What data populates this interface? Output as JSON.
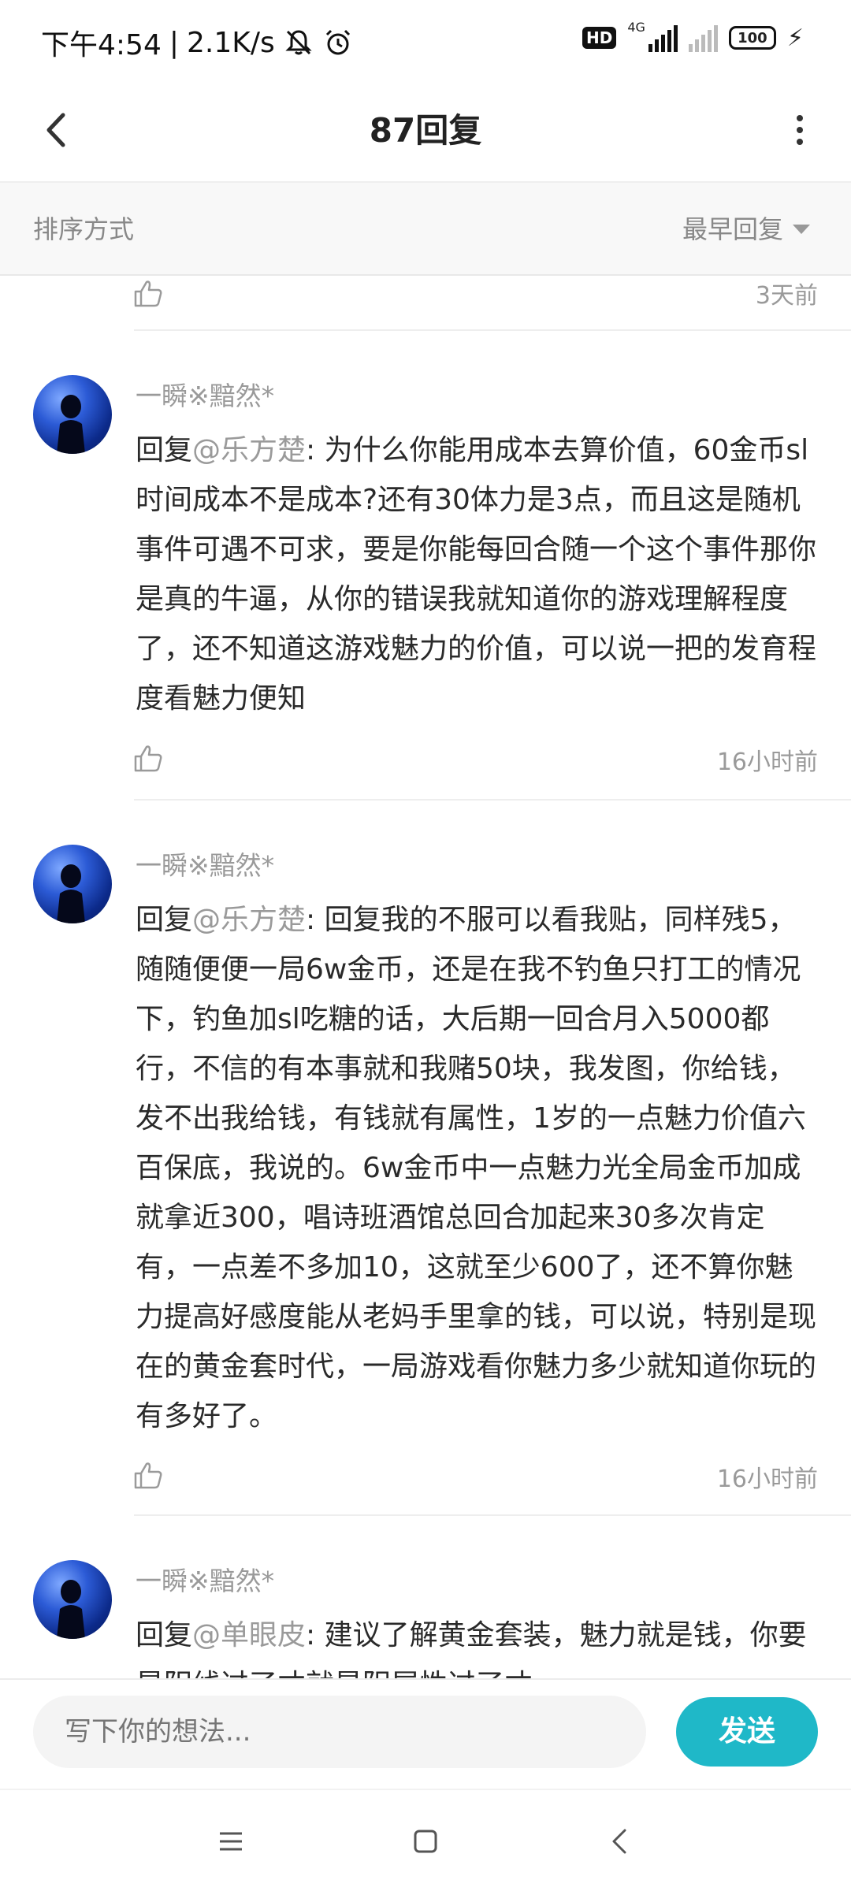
{
  "status_bar": {
    "time": "下午4:54",
    "speed": "2.1K/s",
    "hd_label": "HD",
    "network": "4G",
    "battery": "100"
  },
  "header": {
    "title": "87回复"
  },
  "sort": {
    "label": "排序方式",
    "value": "最早回复"
  },
  "comments": [
    {
      "time": "3天前"
    },
    {
      "username": "一瞬※黯然*",
      "reply_prefix": "回复",
      "reply_to": "@乐方楚",
      "text": ": 为什么你能用成本去算价值，60金币sl时间成本不是成本?还有30体力是3点，而且这是随机事件可遇不可求，要是你能每回合随一个这个事件那你是真的牛逼，从你的错误我就知道你的游戏理解程度了，还不知道这游戏魅力的价值，可以说一把的发育程度看魅力便知",
      "time": "16小时前"
    },
    {
      "username": "一瞬※黯然*",
      "reply_prefix": "回复",
      "reply_to": "@乐方楚",
      "text": ": 回复我的不服可以看我贴，同样残5，随随便便一局6w金币，还是在我不钓鱼只打工的情况下，钓鱼加sl吃糖的话，大后期一回合月入5000都行，不信的有本事就和我赌50块，我发图，你给钱，发不出我给钱，有钱就有属性，1岁的一点魅力价值六百保底，我说的。6w金币中一点魅力光全局金币加成就拿近300，唱诗班酒馆总回合加起来30多次肯定有，一点差不多加10，这就至少600了，还不算你魅力提高好感度能从老妈手里拿的钱，可以说，特别是现在的黄金套时代，一局游戏看你魅力多少就知道你玩的有多好了。",
      "time": "16小时前"
    },
    {
      "username": "一瞬※黯然*",
      "reply_prefix": "回复",
      "reply_to": "@单眼皮",
      "text": ": 建议了解黄金套装，魅力就是钱，你要是阴线过了才就是阴属性过了才"
    }
  ],
  "composer": {
    "placeholder": "写下你的想法...",
    "send_label": "发送"
  }
}
